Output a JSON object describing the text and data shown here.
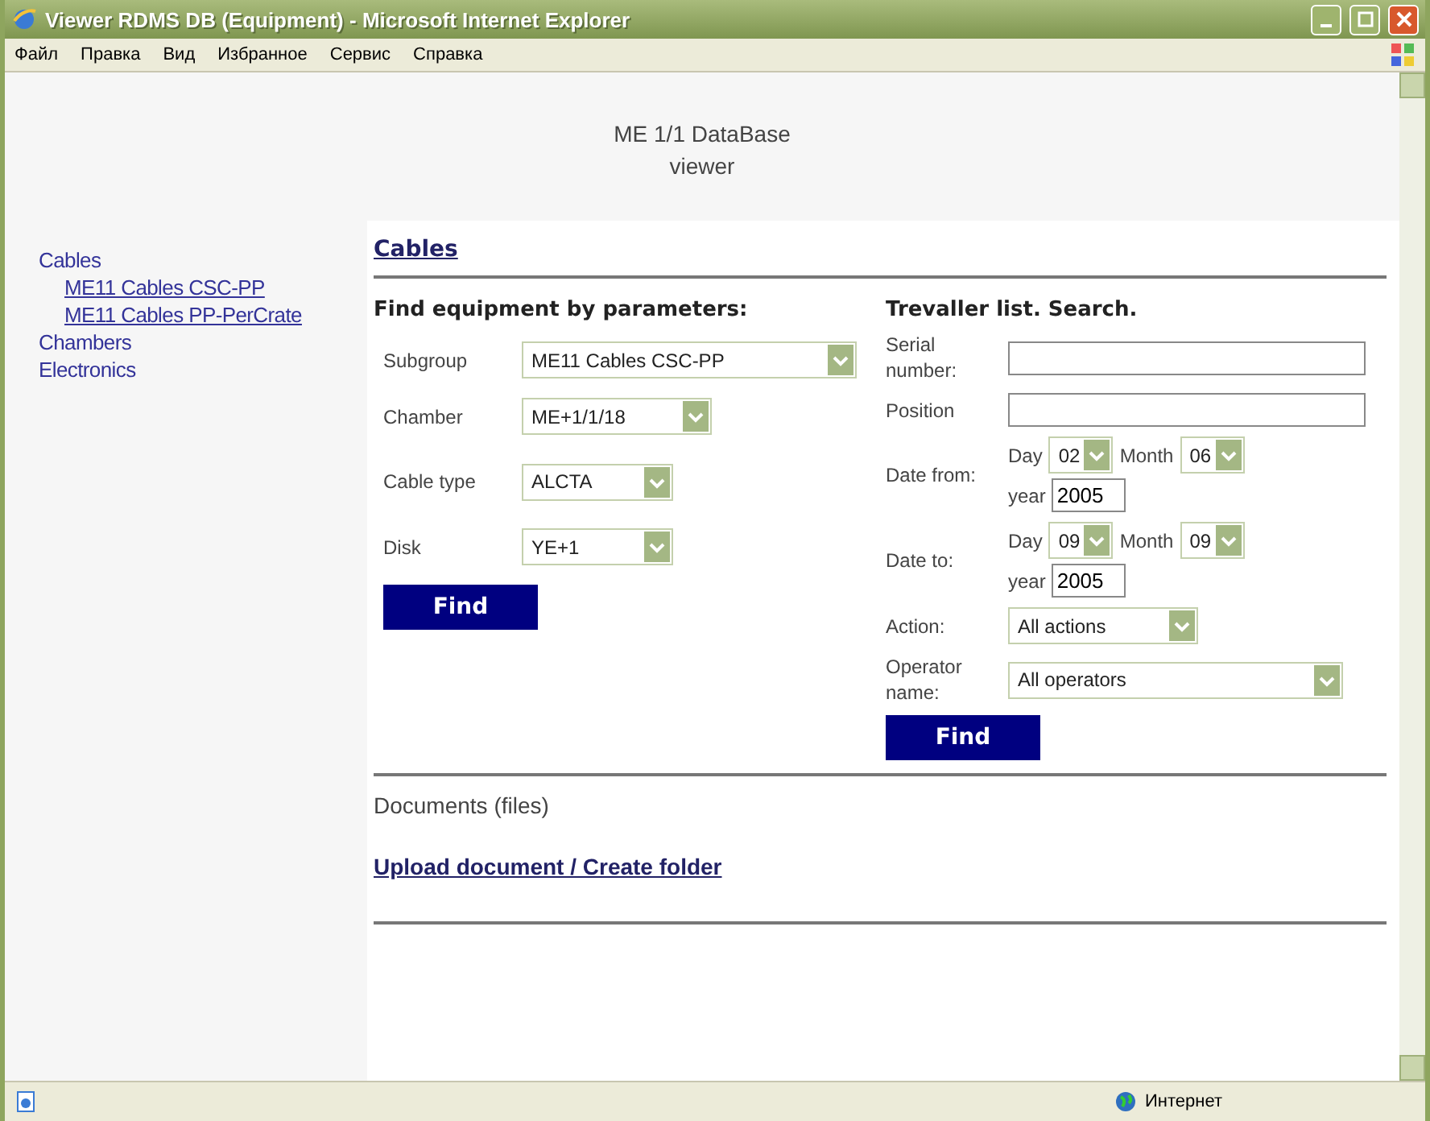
{
  "window": {
    "title": "Viewer RDMS DB (Equipment) - Microsoft Internet Explorer"
  },
  "menu": [
    "Файл",
    "Правка",
    "Вид",
    "Избранное",
    "Сервис",
    "Справка"
  ],
  "header": [
    "ME 1/1 DataBase",
    "viewer"
  ],
  "sidebar": {
    "items": [
      {
        "label": "Cables",
        "children": [
          {
            "label": "ME11 Cables CSC-PP"
          },
          {
            "label": "ME11 Cables PP-PerCrate"
          }
        ]
      },
      {
        "label": "Chambers"
      },
      {
        "label": "Electronics"
      }
    ]
  },
  "section_link": "Cables",
  "equipment_search": {
    "title": "Find equipment by parameters:",
    "fields": [
      {
        "label": "Subgroup",
        "value": "ME11 Cables CSC-PP"
      },
      {
        "label": "Chamber",
        "value": "ME+1/1/18"
      },
      {
        "label": "Cable type",
        "value": "ALCTA"
      },
      {
        "label": "Disk",
        "value": "YE+1"
      }
    ],
    "button": "Find"
  },
  "traveller_search": {
    "title": "Trevaller list. Search.",
    "rows": [
      {
        "kind": "text",
        "label": "Serial number:"
      },
      {
        "kind": "text",
        "label": "Position"
      },
      {
        "kind": "date",
        "label": "Date from:",
        "day_label": "Day",
        "day": "02",
        "month_label": "Month",
        "month": "06",
        "year_label": "year",
        "year": "2005"
      },
      {
        "kind": "date",
        "label": "Date to:",
        "day_label": "Day",
        "day": "09",
        "month_label": "Month",
        "month": "09",
        "year_label": "year",
        "year": "2005"
      },
      {
        "kind": "select",
        "label": "Action:",
        "value": "All actions"
      },
      {
        "kind": "select",
        "label": "Operator name:",
        "value": "All operators"
      }
    ],
    "button": "Find"
  },
  "documents": {
    "title": "Documents (files)",
    "link": "Upload document / Create folder"
  },
  "status_bar": {
    "zone": "Интернет"
  }
}
